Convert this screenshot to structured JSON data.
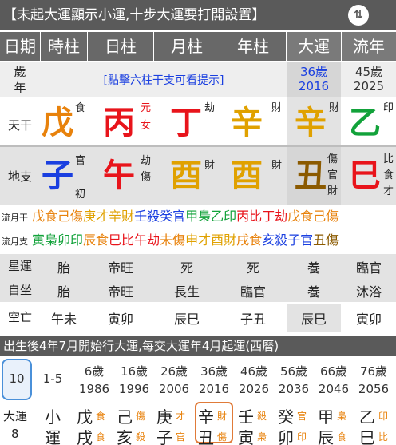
{
  "banner": {
    "text": "【未起大運顯示小運,十步大運要打開設置】",
    "swap_icon": "swap-icon"
  },
  "columns": {
    "row_label": "日期",
    "hour": "時柱",
    "day": "日柱",
    "month": "月柱",
    "year": "年柱",
    "dayun": "大運",
    "liunian": "流年"
  },
  "age_row": {
    "label_top": "歲",
    "label_bottom": "年",
    "hint": "[點擊六柱干支可看提示]",
    "dayun_age": "36歲",
    "dayun_year": "2016",
    "liunian_age": "45歲",
    "liunian_year": "2025"
  },
  "tiangan": {
    "label": "天干",
    "hour": {
      "char": "戊",
      "god": "食"
    },
    "day": {
      "char": "丙",
      "god_top": "元",
      "god_bottom": "女"
    },
    "month": {
      "char": "丁",
      "god": "劫"
    },
    "year": {
      "char": "辛",
      "god": "財"
    },
    "dayun": {
      "char": "辛",
      "god": "財"
    },
    "liunian": {
      "char": "乙",
      "god": "印"
    }
  },
  "dizhi": {
    "label": "地支",
    "hour": {
      "char": "子",
      "god_top": "官",
      "god_bottom": "初"
    },
    "day": {
      "char": "午",
      "god_top": "劫",
      "god_bottom": "傷"
    },
    "month": {
      "char": "酉",
      "god": "財"
    },
    "year": {
      "char": "酉",
      "god": "財"
    },
    "dayun": {
      "char": "丑",
      "god_top": "傷",
      "god_mid": "官",
      "god_bottom": "財"
    },
    "liunian": {
      "char": "巳",
      "god_top": "比",
      "god_mid": "食",
      "god_bottom": "才"
    }
  },
  "liuyue_gan": {
    "label": "流月干",
    "items": [
      "戊食",
      "己傷",
      "庚才",
      "辛財",
      "壬殺",
      "癸官",
      "甲梟",
      "乙印",
      "丙比",
      "丁劫",
      "戊食",
      "己傷"
    ]
  },
  "liuyue_zhi": {
    "label": "流月支",
    "items": [
      "寅梟",
      "卯印",
      "辰食",
      "巳比",
      "午劫",
      "未傷",
      "申才",
      "酉財",
      "戌食",
      "亥殺",
      "子官",
      "丑傷"
    ]
  },
  "xingyun": {
    "label": "星運",
    "hour": "胎",
    "day": "帝旺",
    "month": "死",
    "year": "死",
    "dayun": "養",
    "liunian": "臨官"
  },
  "zizuo": {
    "label": "自坐",
    "hour": "胎",
    "day": "帝旺",
    "month": "長生",
    "year": "臨官",
    "dayun": "養",
    "liunian": "沐浴"
  },
  "kongwang": {
    "label": "空亡",
    "hour": "午未",
    "day": "寅卯",
    "month": "辰巳",
    "year": "子丑",
    "dayun": "辰巳",
    "liunian": "寅卯"
  },
  "dayun_bar": {
    "text": "出生後4年7月開始行大運,每交大運年4月起運(西曆)"
  },
  "dayun_ages": [
    {
      "age": "10",
      "year": ""
    },
    {
      "age": "1-5",
      "year": ""
    },
    {
      "age": "6歲",
      "year": "1986"
    },
    {
      "age": "16歲",
      "year": "1996"
    },
    {
      "age": "26歲",
      "year": "2006"
    },
    {
      "age": "36歲",
      "year": "2016"
    },
    {
      "age": "46歲",
      "year": "2026"
    },
    {
      "age": "56歲",
      "year": "2036"
    },
    {
      "age": "66歲",
      "year": "2046"
    },
    {
      "age": "76歲",
      "year": "2056"
    }
  ],
  "dayun_list": {
    "label_top": "大運",
    "label_bottom": "8",
    "xiaoyun_top": "小",
    "xiaoyun_bottom": "運",
    "items": [
      {
        "gan": "戊",
        "gan_god": "食",
        "zhi": "戌",
        "zhi_god": "食"
      },
      {
        "gan": "己",
        "gan_god": "傷",
        "zhi": "亥",
        "zhi_god": "殺"
      },
      {
        "gan": "庚",
        "gan_god": "才",
        "zhi": "子",
        "zhi_god": "官"
      },
      {
        "gan": "辛",
        "gan_god": "財",
        "zhi": "丑",
        "zhi_god": "傷"
      },
      {
        "gan": "壬",
        "gan_god": "殺",
        "zhi": "寅",
        "zhi_god": "梟"
      },
      {
        "gan": "癸",
        "gan_god": "官",
        "zhi": "卯",
        "zhi_god": "印"
      },
      {
        "gan": "甲",
        "gan_god": "梟",
        "zhi": "辰",
        "zhi_god": "食"
      },
      {
        "gan": "乙",
        "gan_god": "印",
        "zhi": "巳",
        "zhi_god": "比"
      }
    ]
  },
  "colors": {
    "fire": "#e8141b",
    "earth": "#e8820c",
    "metal": "#e0a100",
    "water": "#1a3fe0",
    "wood": "#12a23a",
    "brown": "#8b5a00",
    "highlight_blue": "#4a90d9",
    "highlight_orange": "#e07b39"
  }
}
